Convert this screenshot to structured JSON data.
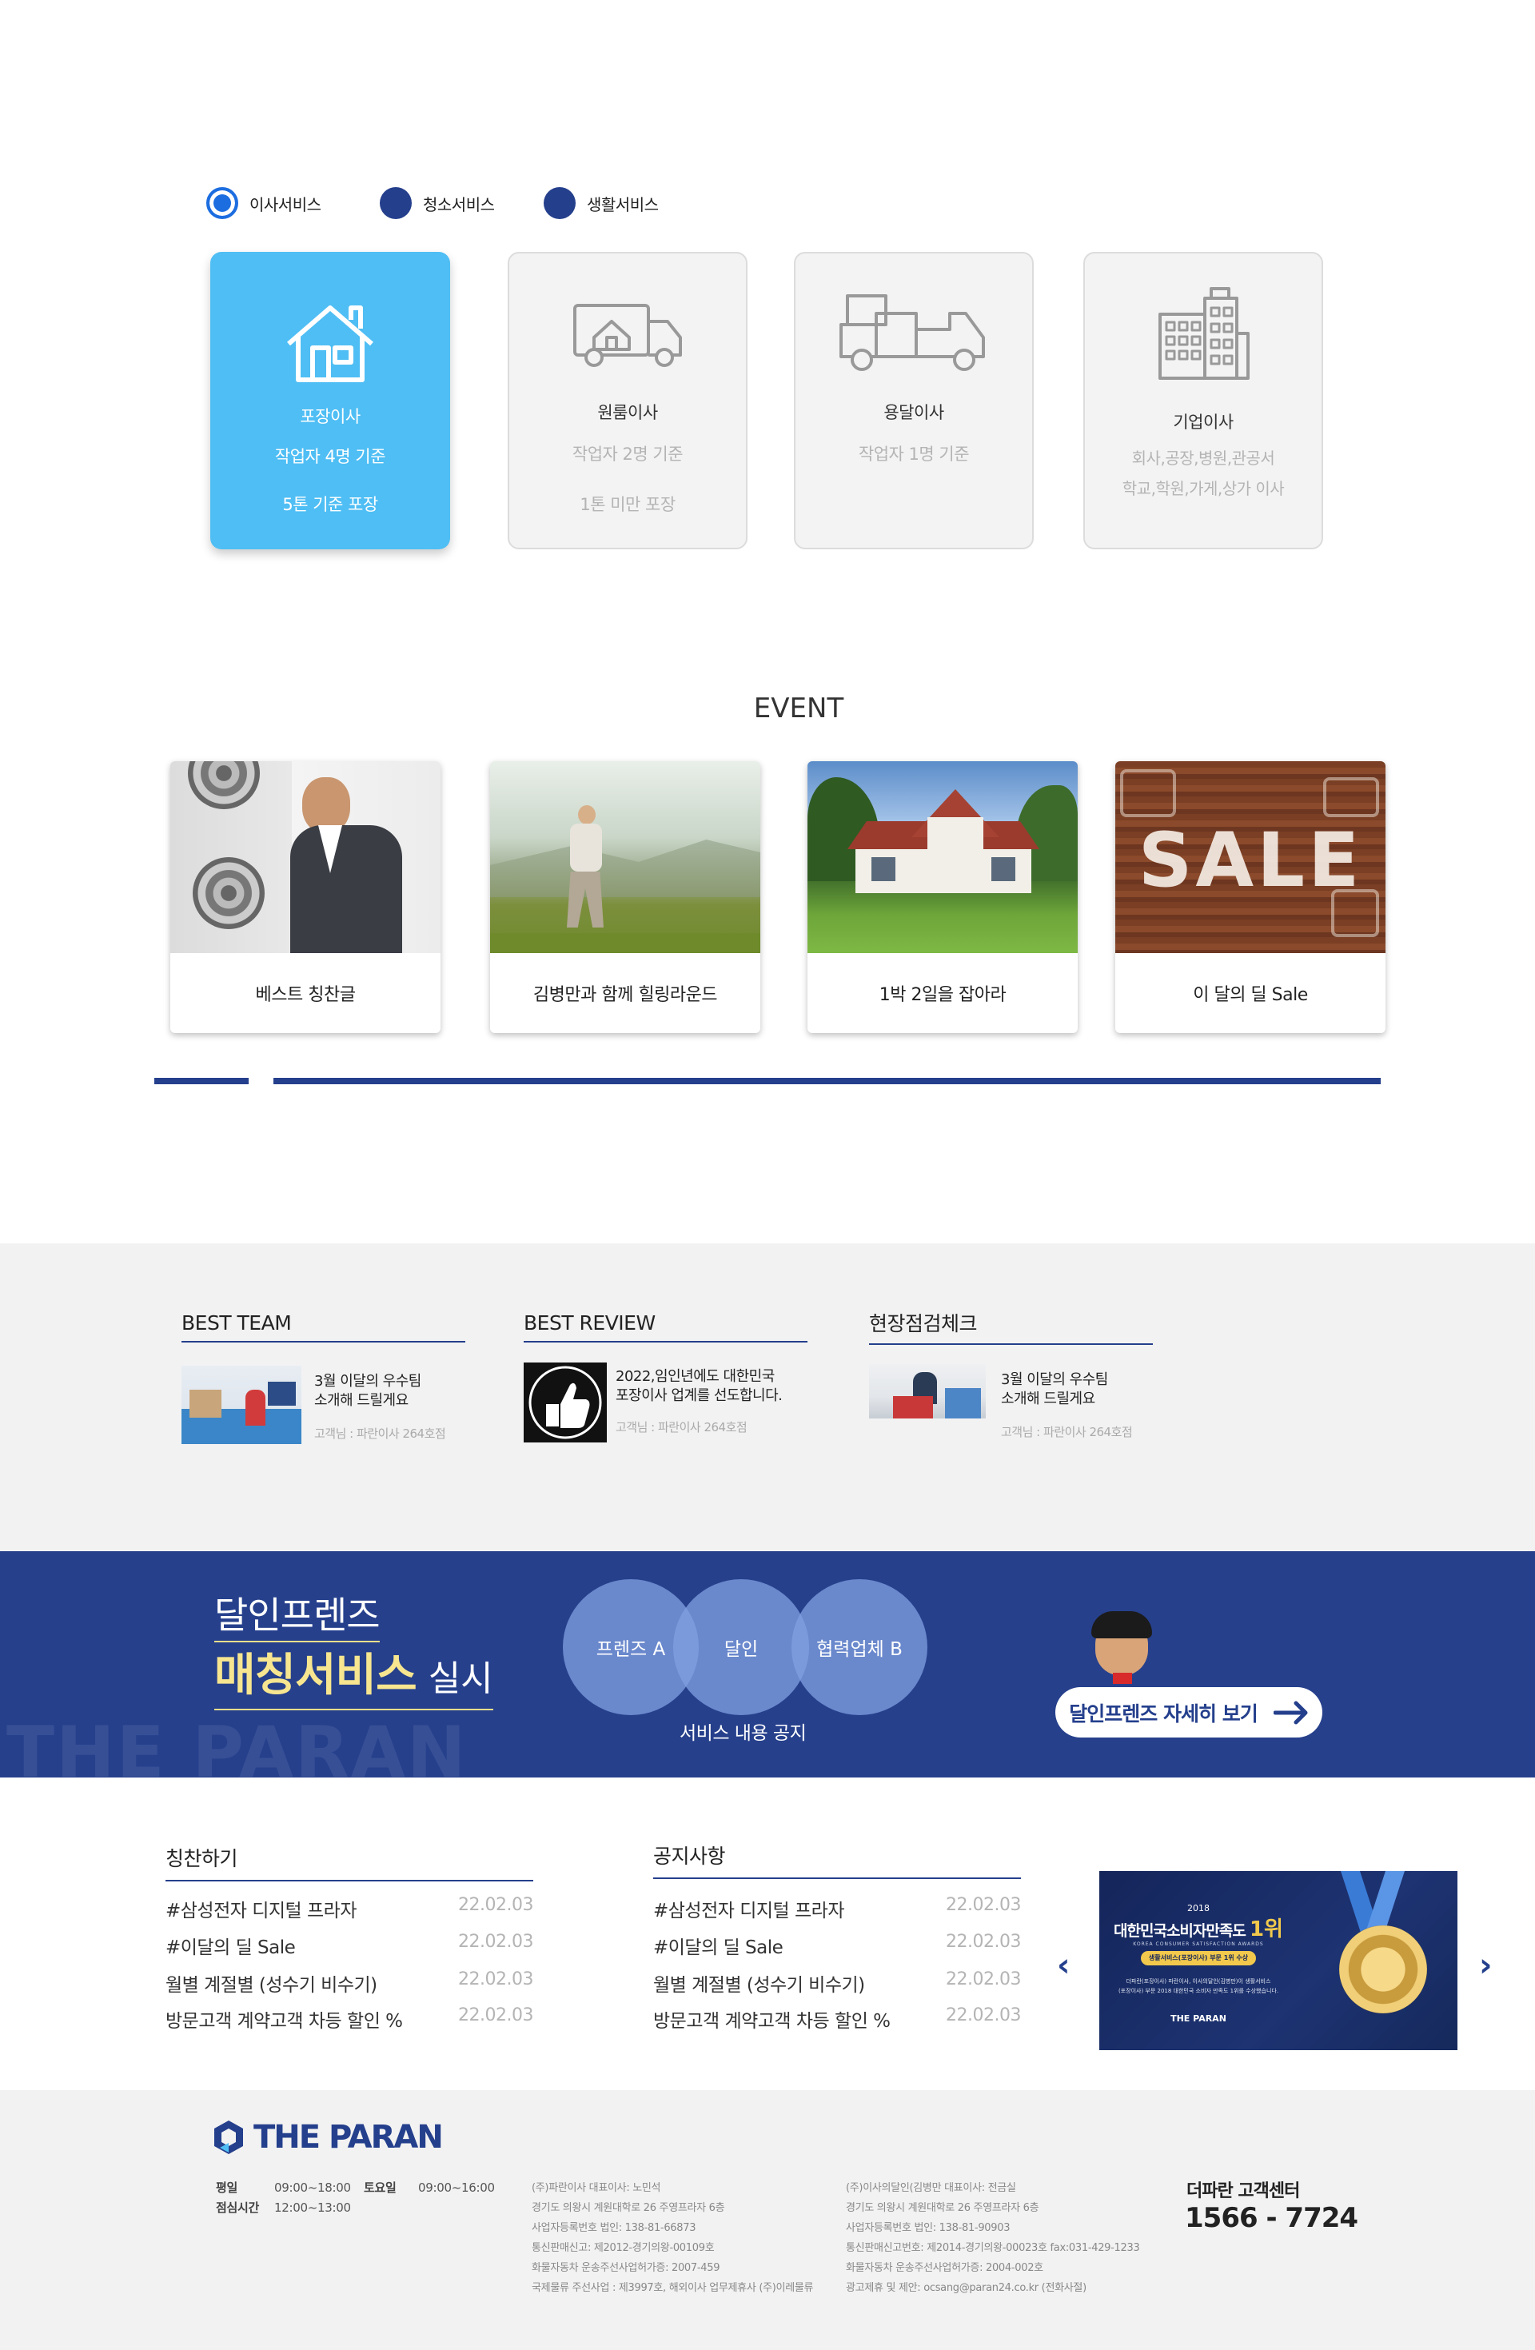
{
  "tabs": [
    {
      "label": "이사서비스",
      "active": true
    },
    {
      "label": "청소서비스",
      "active": false
    },
    {
      "label": "생활서비스",
      "active": false
    }
  ],
  "cards": [
    {
      "icon": "house-icon",
      "title": "포장이사",
      "line1": "작업자 4명 기준",
      "line2": "5톤 기준 포장"
    },
    {
      "icon": "moving-truck-icon",
      "title": "원룸이사",
      "line1": "작업자 2명 기준",
      "line2": "1톤 미만 포장"
    },
    {
      "icon": "cargo-truck-icon",
      "title": "용달이사",
      "line1": "작업자 1명 기준",
      "line2": ""
    },
    {
      "icon": "office-building-icon",
      "title": "기업이사",
      "line1": "회사,공장,병원,관공서",
      "line2": "학교,학원,가게,상가 이사"
    }
  ],
  "event": {
    "title": "EVENT",
    "items": [
      {
        "caption": "베스트 칭찬글"
      },
      {
        "caption": "김병만과 함께 힐링라운드"
      },
      {
        "caption": "1박 2일을 잡아라"
      },
      {
        "caption": "이 달의 딜 Sale"
      }
    ],
    "sale_text": "SALE"
  },
  "best": [
    {
      "title": "BEST TEAM",
      "line1": "3월 이달의 우수팀",
      "line2": "소개해 드릴게요",
      "sub": "고객님 : 파란이사 264호점"
    },
    {
      "title": "BEST REVIEW",
      "line1": "2022,임인년에도 대한민국",
      "line2": "포장이사 업계를 선도합니다.",
      "sub": "고객님 : 파란이사 264호점"
    },
    {
      "title": "현장점검체크",
      "line1": "3월 이달의 우수팀",
      "line2": "소개해 드릴게요",
      "sub": "고객님 : 파란이사 264호점"
    }
  ],
  "banner": {
    "line1": "달인프렌즈",
    "line2": "매칭서비스",
    "line2b": "실시",
    "circles": [
      "프렌즈 A",
      "달인",
      "협력업체 B"
    ],
    "caption": "서비스 내용 공지",
    "watermark": "THE PARAN",
    "button": "달인프렌즈 자세히 보기"
  },
  "praise": {
    "title": "칭찬하기",
    "rows": [
      {
        "t": "#삼성전자 디지털 프라자",
        "d": "22.02.03"
      },
      {
        "t": "#이달의 딜 Sale",
        "d": "22.02.03"
      },
      {
        "t": "월별 계절별 (성수기 비수기)",
        "d": "22.02.03"
      },
      {
        "t": "방문고객 계약고객 차등 할인 %",
        "d": "22.02.03"
      }
    ]
  },
  "notice": {
    "title": "공지사항",
    "rows": [
      {
        "t": "#삼성전자 디지털 프라자",
        "d": "22.02.03"
      },
      {
        "t": "#이달의 딜 Sale",
        "d": "22.02.03"
      },
      {
        "t": "월별 계절별 (성수기 비수기)",
        "d": "22.02.03"
      },
      {
        "t": "방문고객 계약고객 차등 할인 %",
        "d": "22.02.03"
      }
    ]
  },
  "award": {
    "year": "2018",
    "title": "대한민국소비자만족도",
    "rank": "1위",
    "sub": "KOREA CONSUMER SATISFACTION AWARDS",
    "pill": "생활서비스(포장이사) 부문 1위 수상",
    "desc1": "더파란(포장이사) 파란이사, 이사의달인(김병만)이 생활서비스",
    "desc2": "(포장이사) 부문 2018 대한민국 소비자 만족도 1위를 수상했습니다.",
    "logo": "THE PARAN"
  },
  "footer": {
    "logo": "THE PARAN",
    "hours": [
      {
        "k": "평일",
        "v": "09:00~18:00"
      },
      {
        "k": "토요일",
        "v": "09:00~16:00"
      },
      {
        "k": "점심시간",
        "v": "12:00~13:00"
      }
    ],
    "col1": [
      "(주)파란이사 대표이사: 노민석",
      "경기도 의왕시 계원대학로 26 주영프라자 6층",
      "사업자등록번호 법인: 138-81-66873",
      "통신판매신고: 제2012-경기의왕-00109호",
      "화물자동차 운송주선사업허가증: 2007-459",
      "국제물류 주선사업 : 제3997호, 해외이사 업무제휴사 (주)이레물류"
    ],
    "col2": [
      "(주)이사의달인(김병만 대표이사: 전금실",
      "경기도 의왕시 계원대학로 26 주영프라자 6층",
      "사업자등록번호 법인: 138-81-90903",
      "통신판매신고번호: 제2014-경기의왕-00023호 fax:031-429-1233",
      "화물자동차 운송주선사업허가증: 2004-002호",
      "광고제휴 및 제안: ocsang@paran24.co.kr (전화사절)"
    ],
    "cs_label": "더파란 고객센터",
    "cs_phone": "1566 - 7724"
  }
}
